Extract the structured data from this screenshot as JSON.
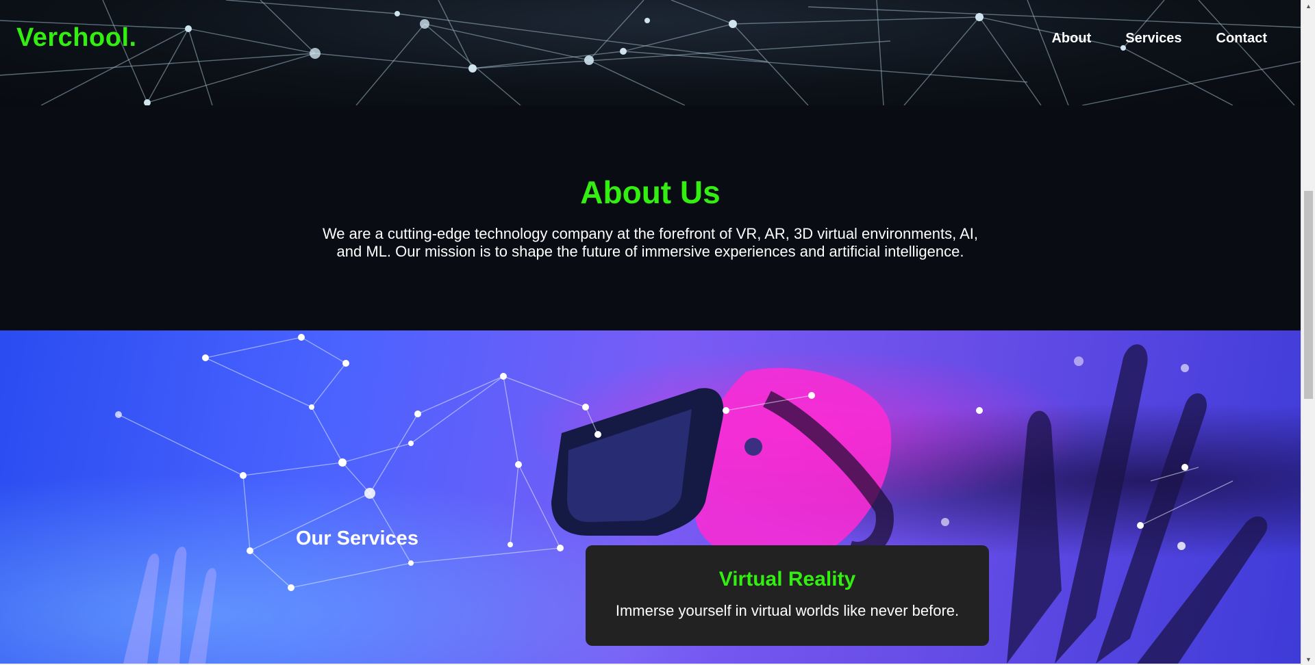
{
  "header": {
    "logo": "Verchool.",
    "nav": [
      "About",
      "Services",
      "Contact"
    ]
  },
  "about": {
    "title": "About Us",
    "text": "We are a cutting-edge technology company at the forefront of VR, AR, 3D virtual environments, AI, and ML. Our mission is to shape the future of immersive experiences and artificial intelligence."
  },
  "services": {
    "title": "Our Services",
    "card": {
      "title": "Virtual Reality",
      "text": "Immerse yourself in virtual worlds like never before."
    }
  },
  "colors": {
    "accent": "#33ee11",
    "background": "#0a0c14",
    "card": "#222222"
  },
  "icons": [
    "scroll-up-arrow-icon",
    "scroll-down-arrow-icon"
  ]
}
